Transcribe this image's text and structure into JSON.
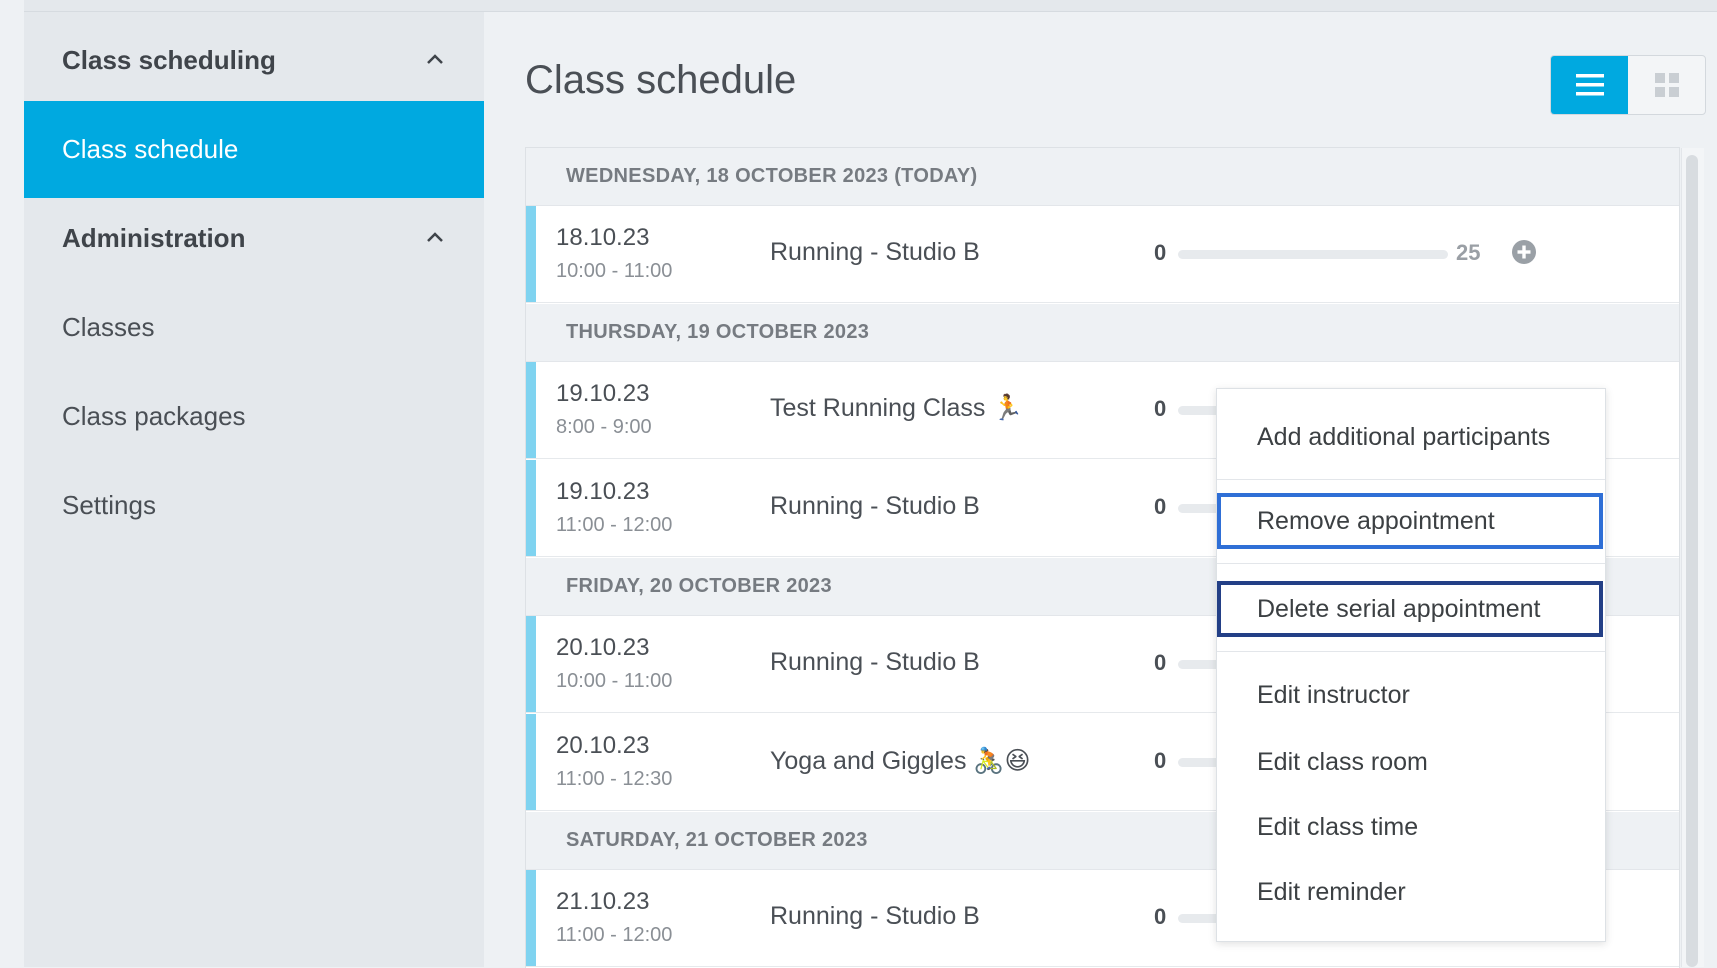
{
  "sidebar": {
    "group1": {
      "label": "Class scheduling",
      "expanded": true
    },
    "active_item": "Class schedule",
    "group2": {
      "label": "Administration",
      "expanded": true
    },
    "items": [
      "Classes",
      "Class packages",
      "Settings"
    ]
  },
  "main": {
    "title": "Class schedule",
    "view_toggle": {
      "active": "list",
      "options": [
        "list-icon",
        "grid-icon"
      ]
    }
  },
  "schedule": {
    "days": [
      {
        "header": "WEDNESDAY, 18 OCTOBER 2023 (TODAY)"
      },
      {
        "header": "THURSDAY, 19 OCTOBER 2023"
      },
      {
        "header": "FRIDAY, 20 OCTOBER 2023"
      },
      {
        "header": "SATURDAY, 21 OCTOBER 2023"
      }
    ],
    "classes": [
      {
        "date": "18.10.23",
        "time": "10:00  -  11:00",
        "name": "Running - Studio B",
        "booked": "0",
        "capacity": "25",
        "fill": 0
      },
      {
        "date": "19.10.23",
        "time": "8:00  -  9:00",
        "name": "Test Running Class 🏃",
        "booked": "0",
        "fill": 0
      },
      {
        "date": "19.10.23",
        "time": "11:00  -  12:00",
        "name": "Running - Studio B",
        "booked": "0",
        "fill": 0
      },
      {
        "date": "20.10.23",
        "time": "10:00  -  11:00",
        "name": "Running - Studio B",
        "booked": "0",
        "fill": 0
      },
      {
        "date": "20.10.23",
        "time": "11:00  -  12:30",
        "name": "Yoga and Giggles 🚴😆",
        "booked": "0",
        "fill": 0
      },
      {
        "date": "21.10.23",
        "time": "11:00  -  12:00",
        "name": "Running - Studio B",
        "booked": "0",
        "fill": 0
      }
    ]
  },
  "context_menu": {
    "items": [
      "Add additional participants",
      "Remove appointment",
      "Delete serial appointment",
      "Edit instructor",
      "Edit class room",
      "Edit class time",
      "Edit reminder"
    ]
  },
  "colors": {
    "accent": "#00a9e0",
    "row_bar": "#7fd3f0",
    "highlight_blue": "#2f6fd6",
    "highlight_navy": "#233f86"
  }
}
